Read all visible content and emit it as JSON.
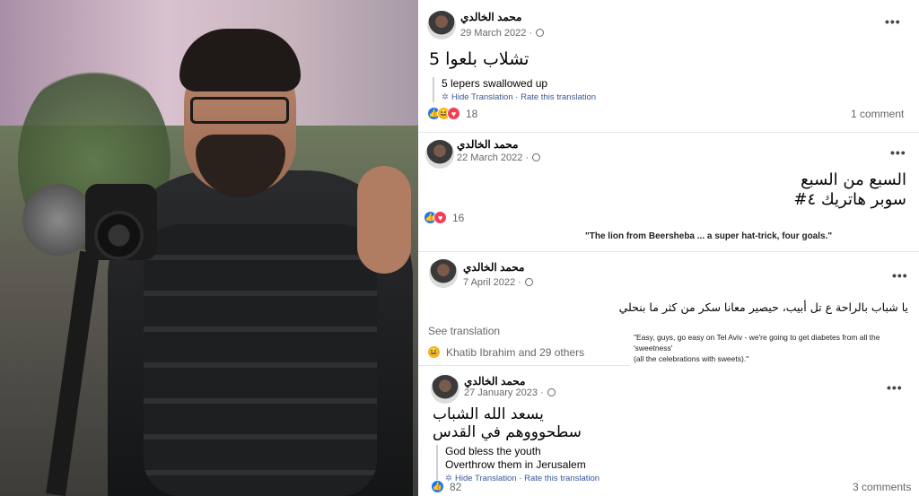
{
  "posts": [
    {
      "author": "محمد الخالدي",
      "date": "29 March 2022",
      "text_lines": [
        "تشلاب بلعوا 5"
      ],
      "translation_lines": [
        "5 lepers swallowed up"
      ],
      "hide_translation": "Hide Translation",
      "rate_translation": "Rate this translation",
      "reaction_count": "18",
      "comments": "1 comment",
      "reactions": [
        "like-icon",
        "haha-icon",
        "heart-icon"
      ]
    },
    {
      "author": "محمد الخالدي",
      "date": "22 March 2022",
      "text_lines": [
        "السبع من السبع",
        "سوبر هاتريك ٤#"
      ],
      "reaction_count": "16",
      "reactions": [
        "like-icon",
        "heart-icon"
      ],
      "caption": "\"The lion from Beersheba ... a super hat-trick, four goals.\""
    },
    {
      "author": "محمد الخالدي",
      "date": "7 April 2022",
      "text_lines": [
        "يا شباب بالراحة ع تل أبيب، حيصير معانا سكر من كثر ما بنحلي"
      ],
      "see_translation": "See translation",
      "reactor_text": "Khatib Ibrahim and 29 others",
      "reactions": [
        "haha-icon"
      ],
      "note_line1": "\"Easy, guys, go easy on Tel Aviv - we're going to get diabetes from all the 'sweetness'",
      "note_line2": "(all the celebrations with sweets).\""
    },
    {
      "author": "محمد الخالدي",
      "date": "27 January 2023",
      "text_lines": [
        "يسعد الله الشباب",
        "سطحوووهم في القدس"
      ],
      "translation_lines": [
        "God bless the youth",
        "Overthrow them in Jerusalem"
      ],
      "hide_translation": "Hide Translation",
      "rate_translation": "Rate this translation",
      "reaction_count": "82",
      "comments": "3 comments",
      "reactions": [
        "like-icon"
      ]
    }
  ],
  "ui": {
    "more_icon": "more-options-icon",
    "dots": "•••",
    "bullet": "·"
  }
}
